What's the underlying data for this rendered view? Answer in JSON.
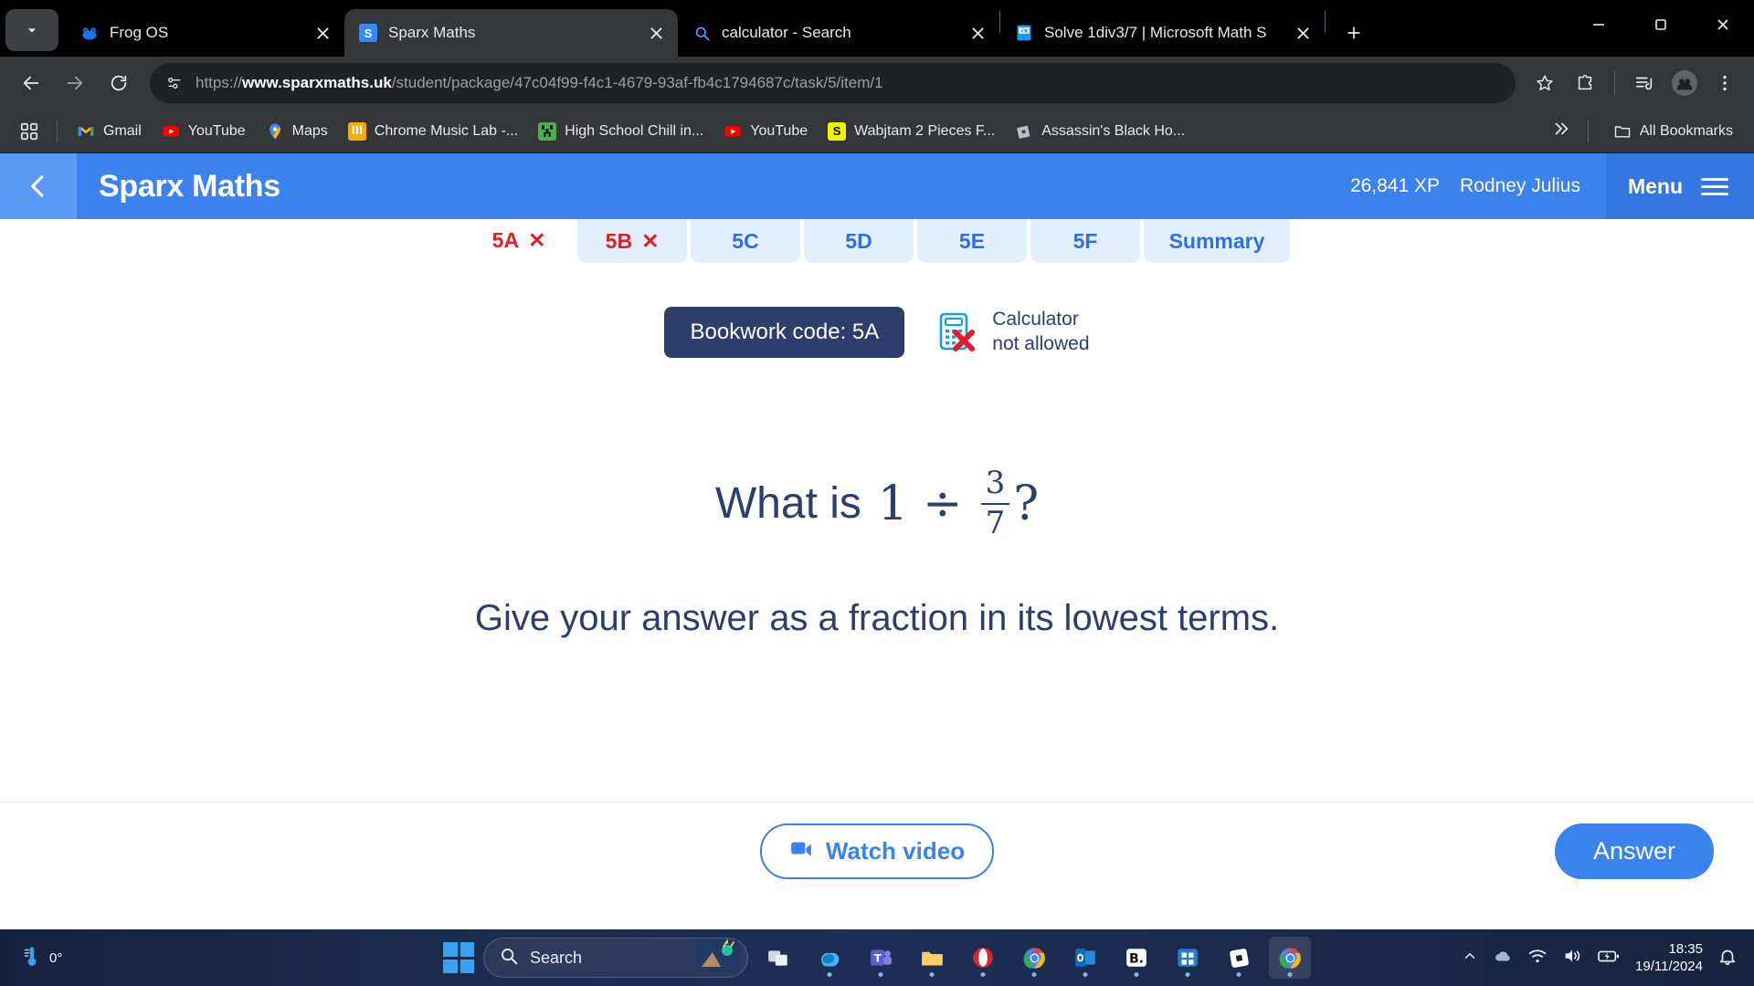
{
  "browser": {
    "tabs": [
      {
        "title": "Frog OS",
        "favicon": "frog-icon",
        "active": false
      },
      {
        "title": "Sparx Maths",
        "favicon": "sparx-s-icon",
        "active": true
      },
      {
        "title": "calculator - Search",
        "favicon": "bing-search-icon",
        "active": false
      },
      {
        "title": "Solve 1div3/7 | Microsoft Math S",
        "favicon": "microsoft-math-icon",
        "active": false
      }
    ],
    "omnibox": {
      "scheme": "https://",
      "host": "www.sparxmaths.uk",
      "path": "/student/package/47c04f99-f4c1-4679-93af-fb4c1794687c/task/5/item/1"
    },
    "bookmarks": [
      {
        "label": "Gmail",
        "icon": "gmail-icon"
      },
      {
        "label": "YouTube",
        "icon": "youtube-icon"
      },
      {
        "label": "Maps",
        "icon": "maps-icon"
      },
      {
        "label": "Chrome Music Lab -...",
        "icon": "music-lab-icon"
      },
      {
        "label": "High School Chill in...",
        "icon": "minecraft-icon"
      },
      {
        "label": "YouTube",
        "icon": "youtube-icon"
      },
      {
        "label": "Wabjtam 2 Pieces F...",
        "icon": "sparx-yellow-icon"
      },
      {
        "label": "Assassin's Black Ho...",
        "icon": "roblox-icon"
      }
    ],
    "all_bookmarks_label": "All Bookmarks"
  },
  "sparx": {
    "brand": "Sparx Maths",
    "xp": "26,841 XP",
    "username": "Rodney Julius",
    "menu_label": "Menu",
    "tabs": [
      {
        "label": "5A",
        "state": "wrong",
        "active": true
      },
      {
        "label": "5B",
        "state": "wrong",
        "active": false
      },
      {
        "label": "5C",
        "state": "normal",
        "active": false
      },
      {
        "label": "5D",
        "state": "normal",
        "active": false
      },
      {
        "label": "5E",
        "state": "normal",
        "active": false
      },
      {
        "label": "5F",
        "state": "normal",
        "active": false
      },
      {
        "label": "Summary",
        "state": "normal",
        "active": false
      }
    ],
    "bookwork_code": "Bookwork code: 5A",
    "calculator_line1": "Calculator",
    "calculator_line2": "not allowed",
    "question": {
      "prefix": "What is",
      "dividend": "1",
      "operator": "÷",
      "fraction_numerator": "3",
      "fraction_denominator": "7",
      "suffix": "?",
      "instruction": "Give your answer as a fraction in its lowest terms."
    },
    "watch_video_label": "Watch video",
    "answer_label": "Answer",
    "colors": {
      "header_blue": "#3b82ef",
      "navy": "#2c3e6b",
      "error_red": "#e02020",
      "tab_light": "#e3effd"
    }
  },
  "taskbar": {
    "weather_temp": "0°",
    "search_placeholder": "Search",
    "apps": [
      "task-view-icon",
      "copilot-icon",
      "microsoft-teams-icon",
      "file-explorer-icon",
      "opera-icon",
      "google-chrome-icon",
      "outlook-icon",
      "bitdefender-icon",
      "microsoft-store-icon",
      "roblox-icon",
      "chrome-active-icon"
    ],
    "time": "18:35",
    "date": "19/11/2024"
  }
}
